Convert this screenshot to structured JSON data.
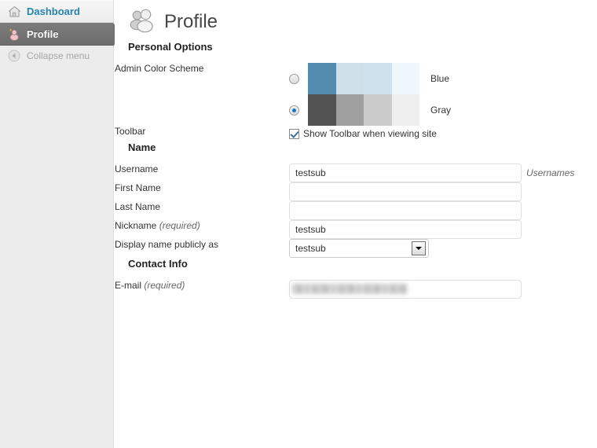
{
  "sidebar": {
    "items": [
      {
        "label": "Dashboard",
        "icon": "home-icon",
        "state": "normal"
      },
      {
        "label": "Profile",
        "icon": "user-icon",
        "state": "active"
      }
    ],
    "collapse": {
      "label": "Collapse menu",
      "icon": "collapse-left-icon"
    }
  },
  "page": {
    "title": "Profile",
    "title_icon": "users-icon"
  },
  "sections": {
    "personal_options": "Personal Options",
    "name": "Name",
    "contact_info": "Contact Info"
  },
  "personal_options": {
    "admin_color_scheme": {
      "label": "Admin Color Scheme",
      "schemes": [
        {
          "name": "Blue",
          "selected": false,
          "colors": [
            "#528bad",
            "#cfdfe9",
            "#cde2ec",
            "#eff6fc"
          ]
        },
        {
          "name": "Gray",
          "selected": true,
          "colors": [
            "#535353",
            "#a0a0a0",
            "#cbcbcb",
            "#efefef"
          ]
        }
      ]
    },
    "toolbar": {
      "label": "Toolbar",
      "checkbox_label": "Show Toolbar when viewing site",
      "checked": true
    }
  },
  "name_fields": {
    "username": {
      "label": "Username",
      "value": "testsub",
      "help": "Usernames"
    },
    "first_name": {
      "label": "First Name",
      "value": ""
    },
    "last_name": {
      "label": "Last Name",
      "value": ""
    },
    "nickname": {
      "label": "Nickname",
      "required_note": "(required)",
      "value": "testsub"
    },
    "display_name": {
      "label": "Display name publicly as",
      "value": "testsub",
      "options": [
        "testsub"
      ]
    }
  },
  "contact_fields": {
    "email": {
      "label": "E-mail",
      "required_note": "(required)",
      "value": "",
      "redacted": true
    }
  },
  "colors": {
    "sidebar_bg": "#ececec",
    "active_item_bg": "#717171",
    "link_blue": "#2583ad",
    "heading_text": "#222222",
    "radio_dot": "#1676c4",
    "check_blue": "#3a6ea5"
  }
}
